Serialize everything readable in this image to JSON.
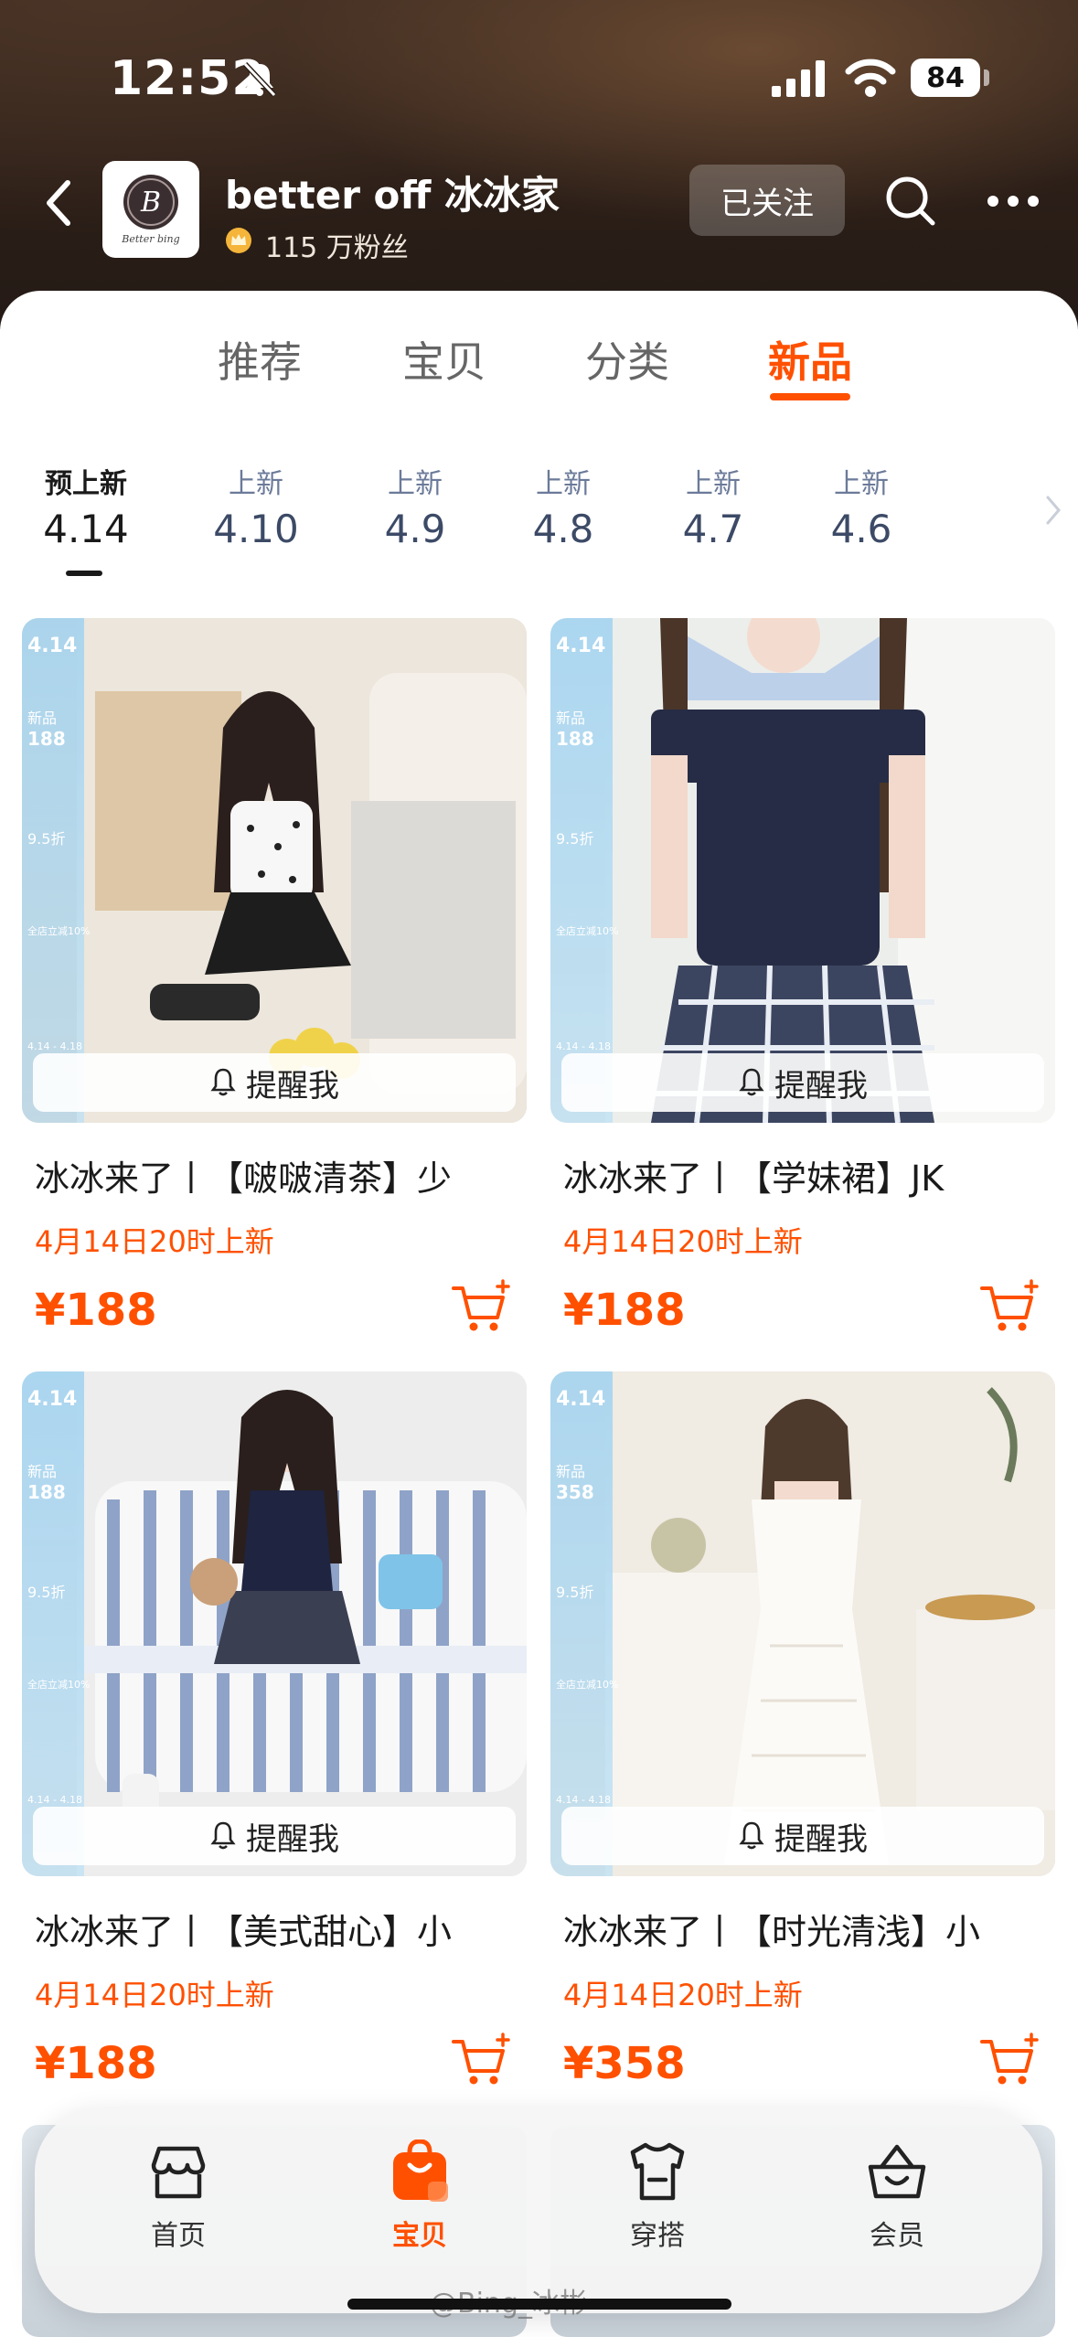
{
  "status_bar": {
    "time": "12:52",
    "battery": "84"
  },
  "shop": {
    "logo_text": "Better bing",
    "name": "better off 冰冰家",
    "fans": "115 万粉丝",
    "follow_label": "已关注"
  },
  "tabs": [
    {
      "label": "推荐"
    },
    {
      "label": "宝贝"
    },
    {
      "label": "分类"
    },
    {
      "label": "新品"
    }
  ],
  "active_tab": "新品",
  "dates": [
    {
      "label": "预上新",
      "date": "4.14"
    },
    {
      "label": "上新",
      "date": "4.10"
    },
    {
      "label": "上新",
      "date": "4.9"
    },
    {
      "label": "上新",
      "date": "4.8"
    },
    {
      "label": "上新",
      "date": "4.7"
    },
    {
      "label": "上新",
      "date": "4.6"
    }
  ],
  "products": [
    {
      "title": "冰冰来了丨【啵啵清茶】少",
      "launch": "4月14日20时上新",
      "price": "¥188",
      "remind": "提醒我",
      "strip": [
        "4.14",
        "新品",
        "188",
        "9.5折",
        "全店立减10%",
        "4.14 - 4.18"
      ]
    },
    {
      "title": "冰冰来了丨【学妹裙】JK",
      "launch": "4月14日20时上新",
      "price": "¥188",
      "remind": "提醒我",
      "strip": [
        "4.14",
        "新品",
        "188",
        "9.5折",
        "全店立减10%",
        "4.14 - 4.18"
      ]
    },
    {
      "title": "冰冰来了丨【美式甜心】小",
      "launch": "4月14日20时上新",
      "price": "¥188",
      "remind": "提醒我",
      "strip": [
        "4.14",
        "新品",
        "188",
        "9.5折",
        "全店立减10%",
        "4.14 - 4.18"
      ]
    },
    {
      "title": "冰冰来了丨【时光清浅】小",
      "launch": "4月14日20时上新",
      "price": "¥358",
      "remind": "提醒我",
      "strip": [
        "4.14",
        "新品",
        "358",
        "9.5折",
        "全店立减10%",
        "4.14 - 4.18"
      ]
    }
  ],
  "bottom_nav": [
    {
      "label": "首页",
      "icon": "shop-home-icon"
    },
    {
      "label": "宝贝",
      "icon": "bag-icon"
    },
    {
      "label": "穿搭",
      "icon": "tshirt-icon"
    },
    {
      "label": "会员",
      "icon": "member-basket-icon"
    }
  ],
  "watermark": "@Bing_冰彬",
  "colors": {
    "accent": "#ff5000",
    "header_dark": "#2c1f18"
  }
}
